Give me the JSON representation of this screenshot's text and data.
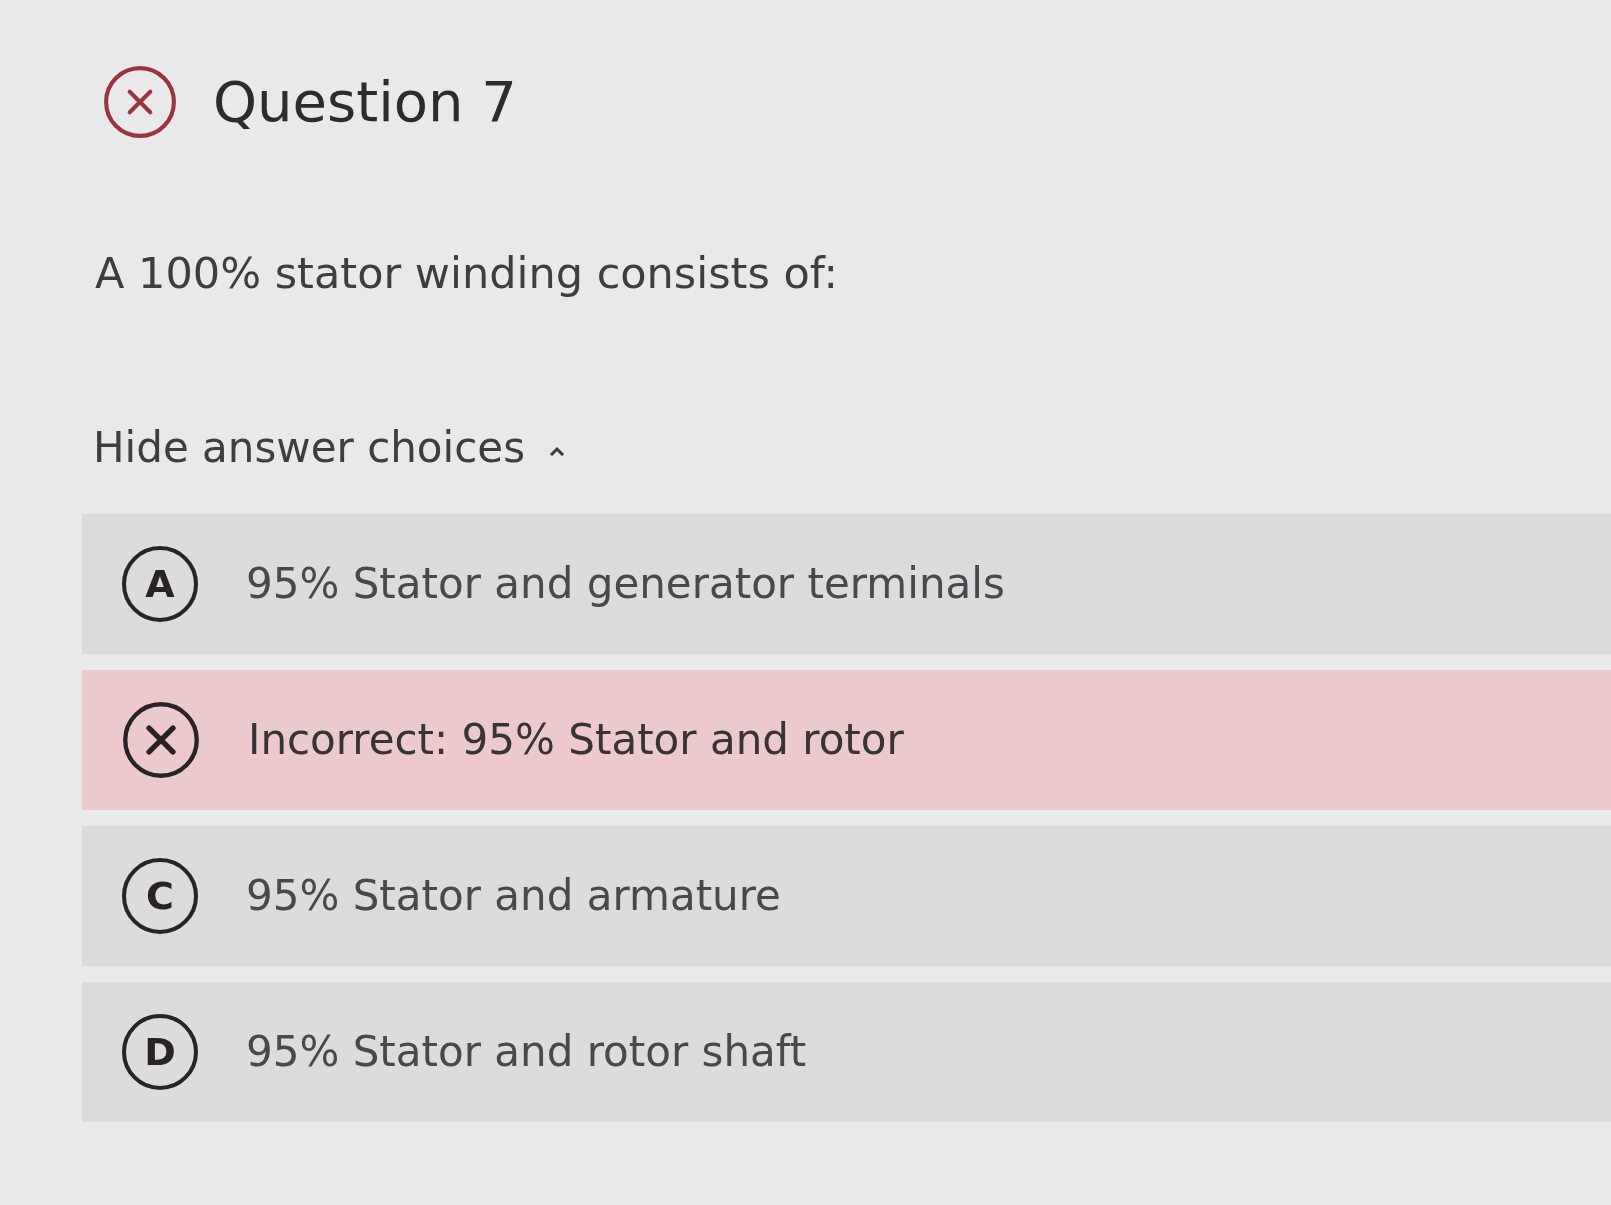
{
  "question": {
    "correct": false,
    "title": "Question 7",
    "prompt": "A 100% stator winding consists of:"
  },
  "toggle": {
    "label": "Hide answer choices",
    "expanded": true
  },
  "choices": [
    {
      "kind": "letter",
      "letter": "A",
      "text": "95% Stator and generator terminals",
      "selected": false
    },
    {
      "kind": "incorrect",
      "text": "Incorrect: 95% Stator and rotor",
      "selected": true
    },
    {
      "kind": "letter",
      "letter": "C",
      "text": "95% Stator and armature",
      "selected": false
    },
    {
      "kind": "letter",
      "letter": "D",
      "text": "95% Stator and rotor shaft",
      "selected": false
    }
  ]
}
